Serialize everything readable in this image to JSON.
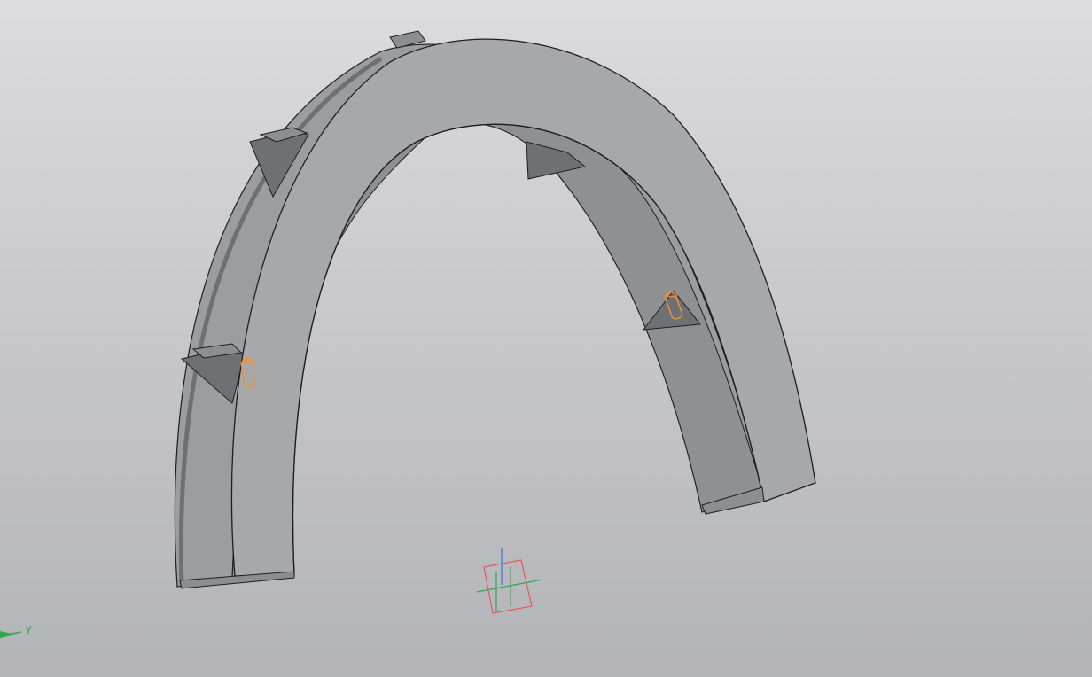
{
  "app": {
    "type": "3d-cad-viewport",
    "model": "arch-frame-assembly"
  },
  "axis_indicator": {
    "y_label": "Y",
    "color": "#2fa84a"
  },
  "colors": {
    "background_top": "#dcdcde",
    "background_bottom": "#b3b4b8",
    "face_main": "#a7a8aa",
    "face_inner": "#9a9b9d",
    "face_dark": "#6f7072",
    "edge": "#1e1e1e",
    "selection_orange": "#f0923a",
    "axis_x": "#e84a4a",
    "axis_y": "#2fa84a",
    "axis_z": "#3a6fe8"
  },
  "icons": {
    "origin": "origin-triad-icon",
    "view_axis": "y-axis-arrow-icon"
  }
}
